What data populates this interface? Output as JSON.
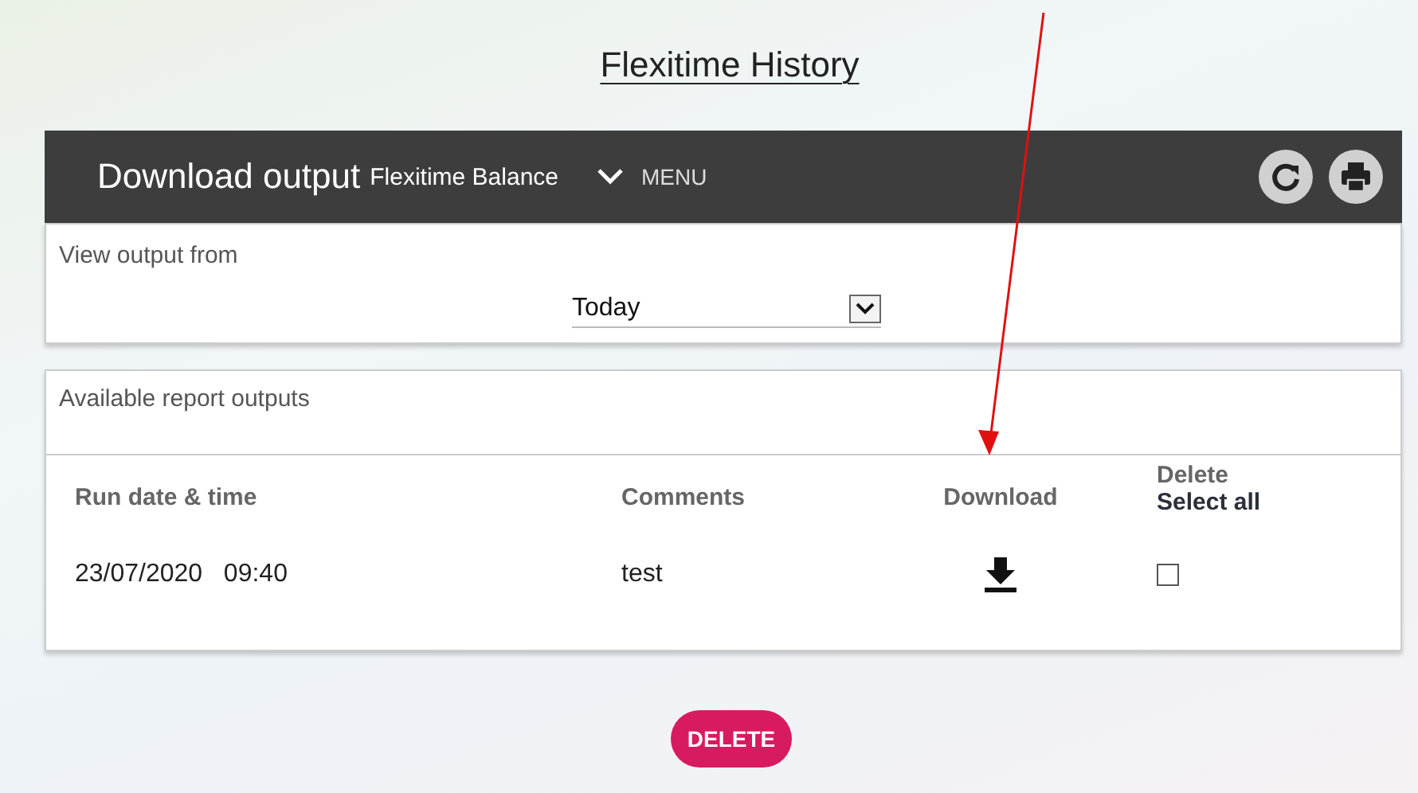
{
  "page_title": "Flexitime History",
  "header": {
    "title": "Download output",
    "report": "Flexitime Balance",
    "menu": "MENU"
  },
  "view_panel": {
    "label": "View output from",
    "period": "Today"
  },
  "outputs_panel": {
    "title": "Available report outputs",
    "columns": [
      "Run date & time",
      "Comments",
      "Download"
    ],
    "delete_column": {
      "label": "Delete",
      "select_all": "Select all"
    },
    "rows": [
      {
        "date": "23/07/2020",
        "time": "09:40",
        "comment": "test",
        "checked": false
      }
    ]
  },
  "delete_button": "DELETE"
}
